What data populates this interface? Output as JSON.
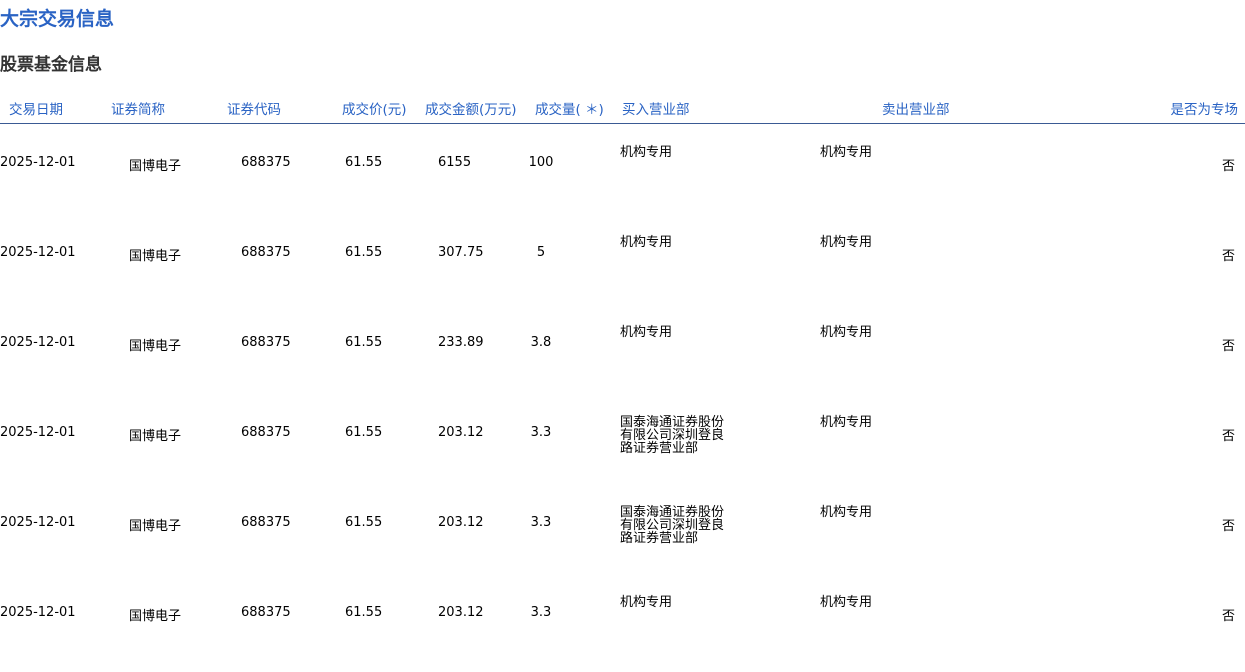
{
  "title": "大宗交易信息",
  "subtitle": "股票基金信息",
  "headers": [
    "交易日期",
    "证券简称",
    "证券代码",
    "成交价(元)",
    "成交金额(万元)",
    "成交量( ＊)",
    "买入营业部",
    "卖出营业部",
    "是否为专场"
  ],
  "rows": [
    {
      "date": "2025-12-01",
      "name": "国博电子",
      "code": "688375",
      "price": "61.55",
      "amount": "6155",
      "volume": "100",
      "buyer": "机构专用",
      "seller": "机构专用",
      "special": "否"
    },
    {
      "date": "2025-12-01",
      "name": "国博电子",
      "code": "688375",
      "price": "61.55",
      "amount": "307.75",
      "volume": "5",
      "buyer": "机构专用",
      "seller": "机构专用",
      "special": "否"
    },
    {
      "date": "2025-12-01",
      "name": "国博电子",
      "code": "688375",
      "price": "61.55",
      "amount": "233.89",
      "volume": "3.8",
      "buyer": "机构专用",
      "seller": "机构专用",
      "special": "否"
    },
    {
      "date": "2025-12-01",
      "name": "国博电子",
      "code": "688375",
      "price": "61.55",
      "amount": "203.12",
      "volume": "3.3",
      "buyer": "国泰海通证券股份有限公司深圳登良路证券营业部",
      "seller": "机构专用",
      "special": "否"
    },
    {
      "date": "2025-12-01",
      "name": "国博电子",
      "code": "688375",
      "price": "61.55",
      "amount": "203.12",
      "volume": "3.3",
      "buyer": "国泰海通证券股份有限公司深圳登良路证券营业部",
      "seller": "机构专用",
      "special": "否"
    },
    {
      "date": "2025-12-01",
      "name": "国博电子",
      "code": "688375",
      "price": "61.55",
      "amount": "203.12",
      "volume": "3.3",
      "buyer": "机构专用",
      "seller": "机构专用",
      "special": "否"
    }
  ]
}
